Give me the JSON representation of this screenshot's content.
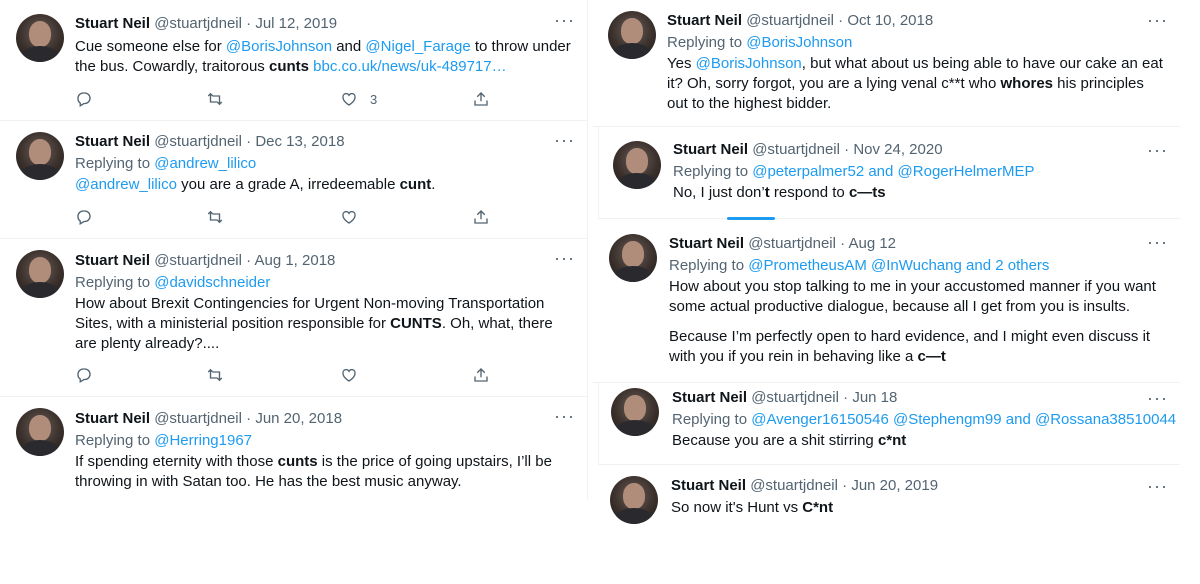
{
  "left": [
    {
      "name": "Stuart Neil",
      "handle": "@stuartjdneil",
      "dot": "·",
      "date": "Jul 12, 2019",
      "text_parts": [
        "Cue someone else for ",
        "@BorisJohnson",
        " and ",
        "@Nigel_Farage",
        " to throw under the bus. Cowardly, traitorous ",
        "cunts",
        " ",
        "bbc.co.uk/news/uk-489717…"
      ],
      "actions": {
        "reply": "",
        "retweet": "",
        "like": "3",
        "share": ""
      }
    },
    {
      "name": "Stuart Neil",
      "handle": "@stuartjdneil",
      "dot": "·",
      "date": "Dec 13, 2018",
      "replying_label": "Replying to ",
      "replying_to": "@andrew_lilico",
      "text_parts": [
        "@andrew_lilico",
        " you are a grade A, irredeemable ",
        "cunt",
        "."
      ],
      "actions": {
        "reply": "",
        "retweet": "",
        "like": "",
        "share": ""
      }
    },
    {
      "name": "Stuart Neil",
      "handle": "@stuartjdneil",
      "dot": "·",
      "date": "Aug 1, 2018",
      "replying_label": "Replying to ",
      "replying_to": "@davidschneider",
      "text_parts": [
        "How about Brexit Contingencies for Urgent Non-moving Transportation Sites, with a ministerial position responsible for ",
        "CUNTS",
        ". Oh, what, there are plenty already?...."
      ],
      "actions": {
        "reply": "",
        "retweet": "",
        "like": "",
        "share": ""
      }
    },
    {
      "name": "Stuart Neil",
      "handle": "@stuartjdneil",
      "dot": "·",
      "date": "Jun 20, 2018",
      "replying_label": "Replying to ",
      "replying_to": "@Herring1967",
      "text_parts": [
        "If spending eternity with those ",
        "cunts",
        " is the price of going upstairs, I’ll be throwing in with Satan too. He has the best music anyway."
      ]
    }
  ],
  "right": [
    {
      "name": "Stuart Neil",
      "handle": "@stuartjdneil",
      "dot": "·",
      "date": "Oct 10, 2018",
      "replying_label": "Replying to ",
      "replying_to": "@BorisJohnson",
      "text_parts": [
        "Yes ",
        "@BorisJohnson",
        ", but what about us being able to have our cake an eat it? Oh, sorry forgot, you are a lying venal c**t who ",
        "whores",
        " his principles out to the highest bidder."
      ]
    },
    {
      "name": "Stuart Neil",
      "handle": "@stuartjdneil",
      "dot": "·",
      "date": "Nov 24, 2020",
      "replying_label": "Replying to ",
      "replying_to": "@peterpalmer52",
      "replying_and": " and ",
      "replying_to2": "@RogerHelmerMEP",
      "text_parts": [
        "No, I just don’",
        "t",
        " respond to ",
        "c—ts"
      ]
    },
    {
      "name": "Stuart Neil",
      "handle": "@stuartjdneil",
      "dot": "·",
      "date": "Aug 12",
      "replying_label": "Replying to ",
      "replying_to": "@PrometheusAM",
      "replying_to2": "@InWuchang",
      "replying_and": " and ",
      "replying_others": "2 others",
      "para1": "How about you stop talking to me in your accustomed manner if you want some actual productive dialogue, because all I get from you is insults.",
      "para2_parts": [
        "Because I’m perfectly open to hard evidence, and I might even discuss it with you if you rein in behaving like a ",
        "c—t"
      ]
    },
    {
      "name": "Stuart Neil",
      "handle": "@stuartjdneil",
      "dot": "·",
      "date": "Jun 18",
      "replying_label": "Replying to ",
      "replying_to": "@Avenger16150546",
      "replying_to2": "@Stephengm99",
      "replying_and": " and ",
      "replying_to3": "@Rossana38510044",
      "text_parts": [
        "Because you are a shit stirring ",
        "c*nt"
      ]
    },
    {
      "name": "Stuart Neil",
      "handle": "@stuartjdneil",
      "dot": "·",
      "date": "Jun 20, 2019",
      "text_parts": [
        "So now it's Hunt vs ",
        "C*nt"
      ]
    }
  ],
  "more_glyph": "···",
  "colors": {
    "link": "#1d9bf0",
    "muted": "#536471",
    "text": "#0f1419",
    "border": "#eff3f4"
  },
  "icons": [
    "reply-icon",
    "retweet-icon",
    "like-icon",
    "share-icon",
    "more-icon",
    "avatar"
  ]
}
